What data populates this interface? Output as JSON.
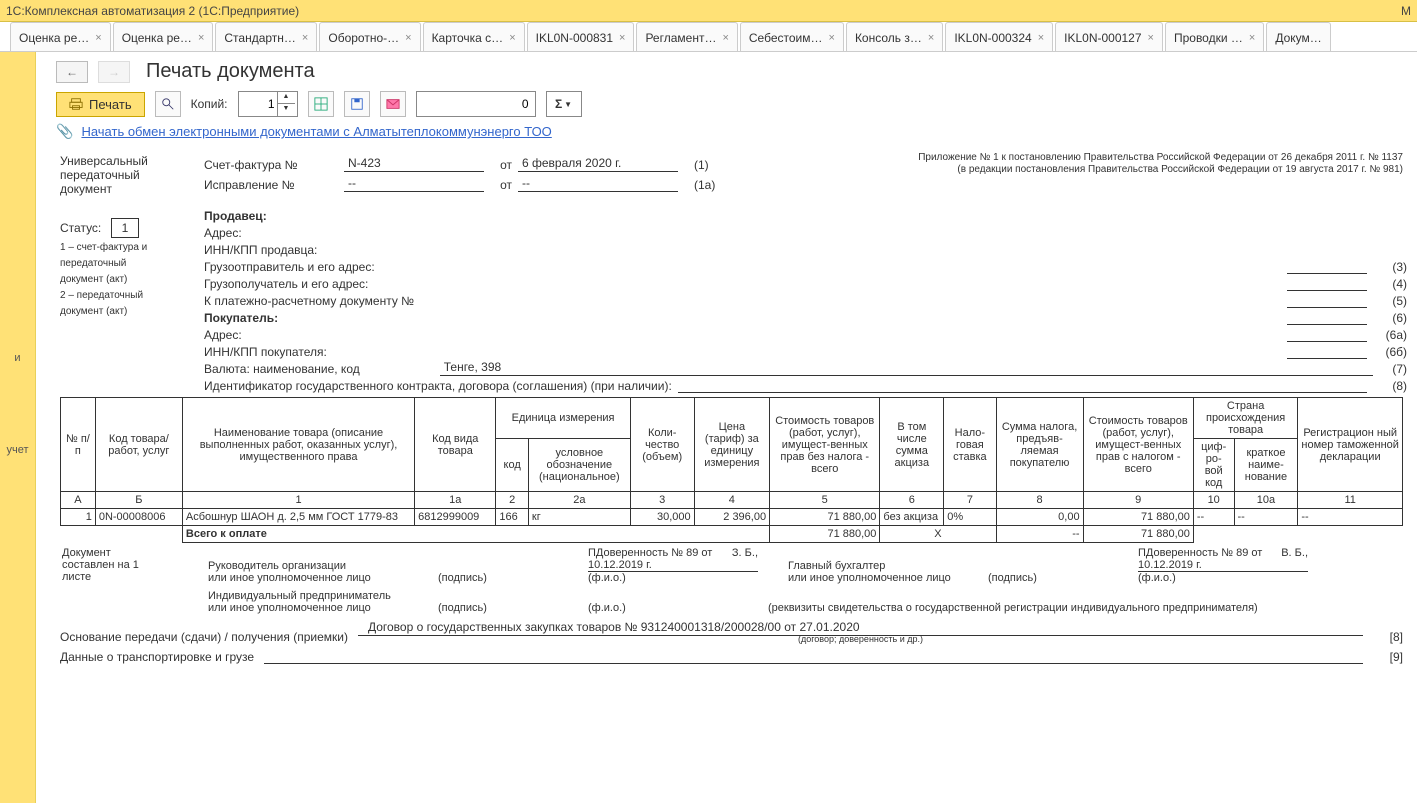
{
  "app": {
    "title": "1С:Комплексная автоматизация 2  (1С:Предприятие)",
    "m": "M"
  },
  "tabs": [
    "Оценка ре…",
    "Оценка ре…",
    "Стандартн…",
    "Оборотно-…",
    "Карточка с…",
    "IKL0N-000831",
    "Регламент…",
    "Себестоим…",
    "Консоль з…",
    "IKL0N-000324",
    "IKL0N-000127",
    "Проводки …",
    "Докум…"
  ],
  "rail": {
    "a": "и",
    "b": "учет"
  },
  "page": {
    "title": "Печать документа",
    "print": "Печать",
    "copies_lbl": "Копий:",
    "copies": "1",
    "num": "0",
    "sigma": "Σ",
    "link": "Начать обмен электронными документами с Алматытеплокоммунэнерго ТОО"
  },
  "side": {
    "t1": "Универсальный",
    "t2": "передаточный",
    "t3": "документ",
    "status_lbl": "Статус:",
    "status": "1",
    "s1": "1 – счет-фактура и",
    "s2": "передаточный",
    "s3": "документ (акт)",
    "s4": "2 – передаточный",
    "s5": "документ (акт)"
  },
  "hdr": {
    "sf_lbl": "Счет-фактура №",
    "sf_num": "N-423",
    "sf_ot": "от",
    "sf_date": "6 февраля 2020 г.",
    "sf_n": "(1)",
    "is_lbl": "Исправление №",
    "is_num": "--",
    "is_ot": "от",
    "is_date": "--",
    "is_n": "(1а)",
    "app1": "Приложение № 1 к постановлению Правительства Российской Федерации от 26 декабря 2011 г. № 1137",
    "app2": "(в редакции постановления Правительства Российской Федерации от 19 августа 2017 г. № 981)"
  },
  "f": {
    "seller": "Продавец:",
    "addr": "Адрес:",
    "inn_s": "ИНН/КПП продавца:",
    "shipper": "Грузоотправитель и его адрес:",
    "consignee": "Грузополучатель и его адрес:",
    "paydoc": "К платежно-расчетному документу №",
    "buyer": "Покупатель:",
    "addr2": "Адрес:",
    "inn_b": "ИНН/КПП покупателя:",
    "curr_lbl": "Валюта: наименование, код",
    "curr": "Тенге, 398",
    "id": "Идентификатор государственного контракта, договора (соглашения) (при наличии):",
    "n3": "(3)",
    "n4": "(4)",
    "n5": "(5)",
    "n6": "(6)",
    "n6a": "(6а)",
    "n66": "(6б)",
    "n7": "(7)",
    "n8": "(8)"
  },
  "th": {
    "c1": "№ п/п",
    "c2": "Код товара/ работ, услуг",
    "c3": "Наименование товара (описание выполненных работ, оказанных услуг), имущественного права",
    "c4": "Код вида товара",
    "c5": "Единица измерения",
    "c5a": "код",
    "c5b": "условное обозначение (национальное)",
    "c6": "Коли-чество (объем)",
    "c7": "Цена (тариф) за единицу измерения",
    "c8": "Стоимость товаров (работ, услуг), имущест-венных прав без налога - всего",
    "c9": "В том числе сумма акциза",
    "c10": "Нало-говая ставка",
    "c11": "Сумма налога, предъяв-ляемая покупателю",
    "c12": "Стоимость товаров (работ, услуг), имущест-венных прав с налогом - всего",
    "c13": "Страна происхождения товара",
    "c13a": "циф-ро-вой код",
    "c13b": "краткое наиме-нование",
    "c14": "Регистрацион ный номер таможенной декларации"
  },
  "thn": {
    "a": "А",
    "b": "Б",
    "c1": "1",
    "c1a": "1а",
    "c2": "2",
    "c2a": "2а",
    "c3": "3",
    "c4": "4",
    "c5": "5",
    "c6": "6",
    "c7": "7",
    "c8": "8",
    "c9": "9",
    "c10": "10",
    "c10a": "10а",
    "c11": "11"
  },
  "row": {
    "n": "1",
    "code": "0N-00008006",
    "name": "Асбошнур ШАОН д.  2,5 мм ГОСТ 1779-83",
    "kind": "6812999009",
    "ucode": "166",
    "uname": "кг",
    "qty": "30,000",
    "price": "2 396,00",
    "sum_no_tax": "71 880,00",
    "excise": "без акциза",
    "rate": "0%",
    "tax": "0,00",
    "sum_tax": "71 880,00",
    "d1": "--",
    "d2": "--",
    "d3": "--"
  },
  "tot": {
    "lbl": "Всего к оплате",
    "s1": "71 880,00",
    "x": "X",
    "s2": "--",
    "s3": "71 880,00"
  },
  "sign": {
    "doc1": "Документ",
    "doc2": "составлен на 1",
    "doc3": "листе",
    "r1": "Руководитель организации",
    "r2": "или иное уполномоченное лицо",
    "ip1": "Индивидуальный предприниматель",
    "ip2": "или иное уполномоченное лицо",
    "p1_i": "П",
    "p1_n": "З. Б.,",
    "p1_d": "Доверенность № 89 от 10.12.2019 г.",
    "gb1": "Главный бухгалтер",
    "gb2": "или иное уполномоченное лицо",
    "p2_i": "П",
    "p2_n": "В. Б.,",
    "p2_d": "Доверенность № 89 от 10.12.2019 г.",
    "cap_sign": "(подпись)",
    "cap_fio": "(ф.и.о.)",
    "cap_req": "(реквизиты свидетельства о государственной  регистрации индивидуального предпринимателя)"
  },
  "basis": {
    "lbl": "Основание передачи (сдачи) / получения (приемки)",
    "val": "Договор о государственных закупках товаров №   931240001318/200028/00 от 27.01.2020",
    "cap": "(договор; доверенность и др.)",
    "n": "[8]",
    "trans": "Данные о транспортировке и грузе",
    "n2": "[9]"
  }
}
